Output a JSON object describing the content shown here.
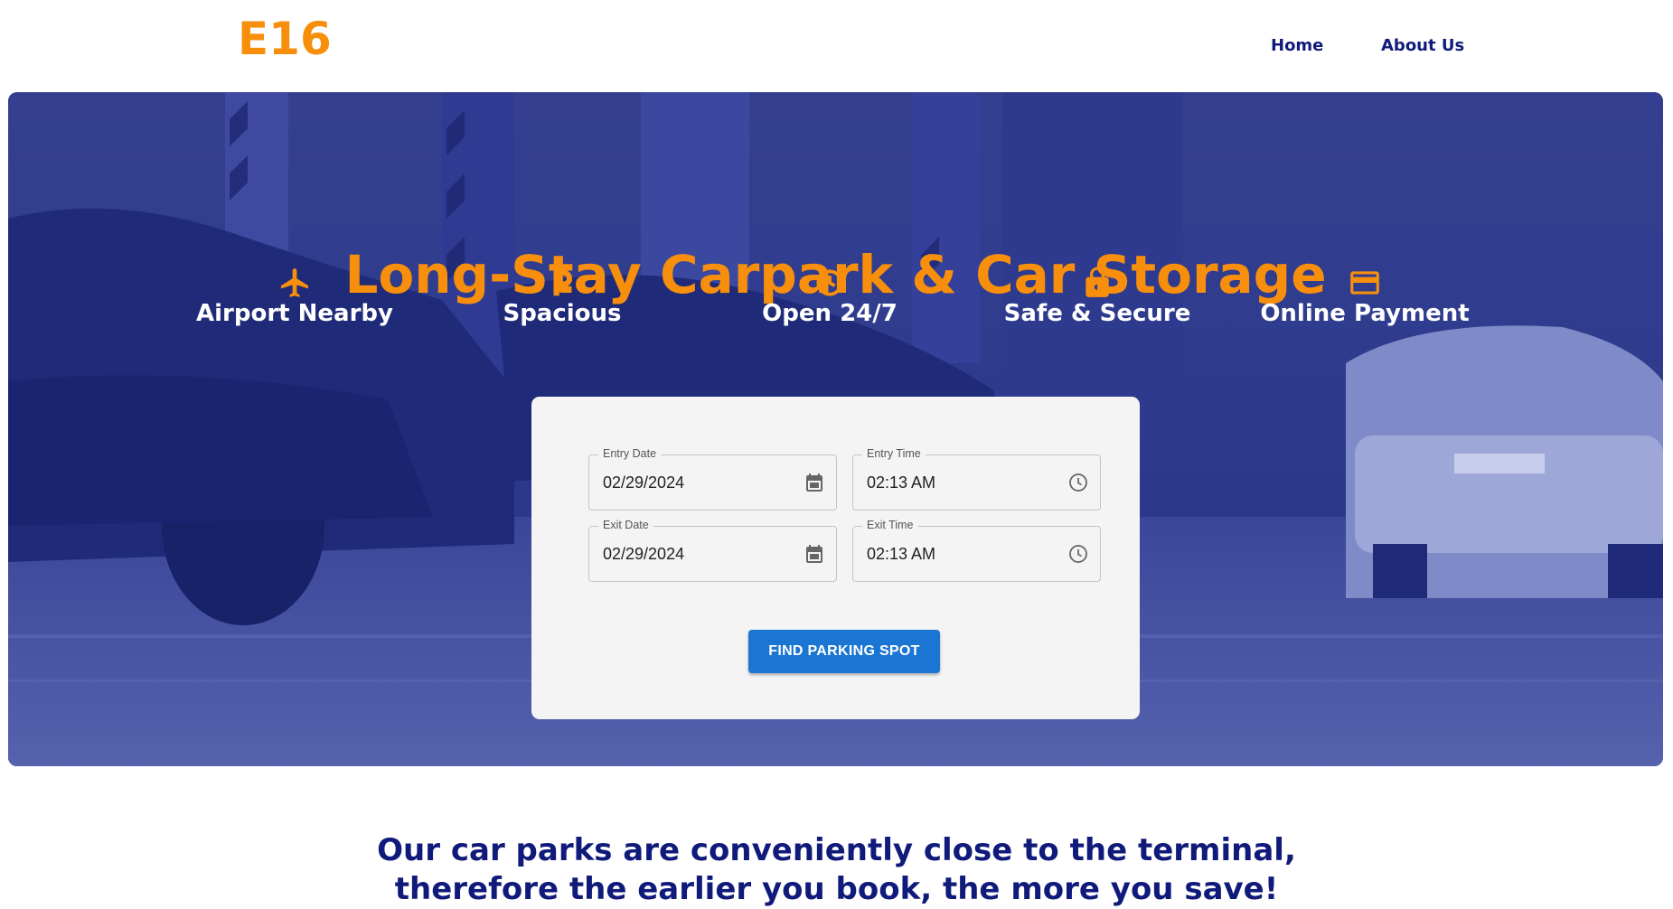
{
  "header": {
    "logo": "E16",
    "nav": {
      "home": "Home",
      "about": "About Us"
    }
  },
  "hero": {
    "title": "Long-Stay Carpark & Car Storage",
    "features": [
      {
        "icon": "airplane-icon",
        "label": "Airport Nearby"
      },
      {
        "icon": "parking-icon",
        "label": "Spacious"
      },
      {
        "icon": "clock-icon",
        "label": "Open 24/7"
      },
      {
        "icon": "lock-icon",
        "label": "Safe & Secure"
      },
      {
        "icon": "credit-card-icon",
        "label": "Online Payment"
      }
    ]
  },
  "form": {
    "entry_date": {
      "label": "Entry Date",
      "value": "02/29/2024"
    },
    "entry_time": {
      "label": "Entry Time",
      "value": "02:13 AM"
    },
    "exit_date": {
      "label": "Exit Date",
      "value": "02/29/2024"
    },
    "exit_time": {
      "label": "Exit Time",
      "value": "02:13 AM"
    },
    "submit_label": "FIND PARKING SPOT"
  },
  "tagline": {
    "line1": "Our car parks are conveniently close to the terminal,",
    "line2": "therefore the earlier you book, the more you save!"
  },
  "colors": {
    "accent": "#f78f0d",
    "navy": "#101a7a",
    "hero_overlay": "#2a3690",
    "button": "#1a76d2"
  }
}
